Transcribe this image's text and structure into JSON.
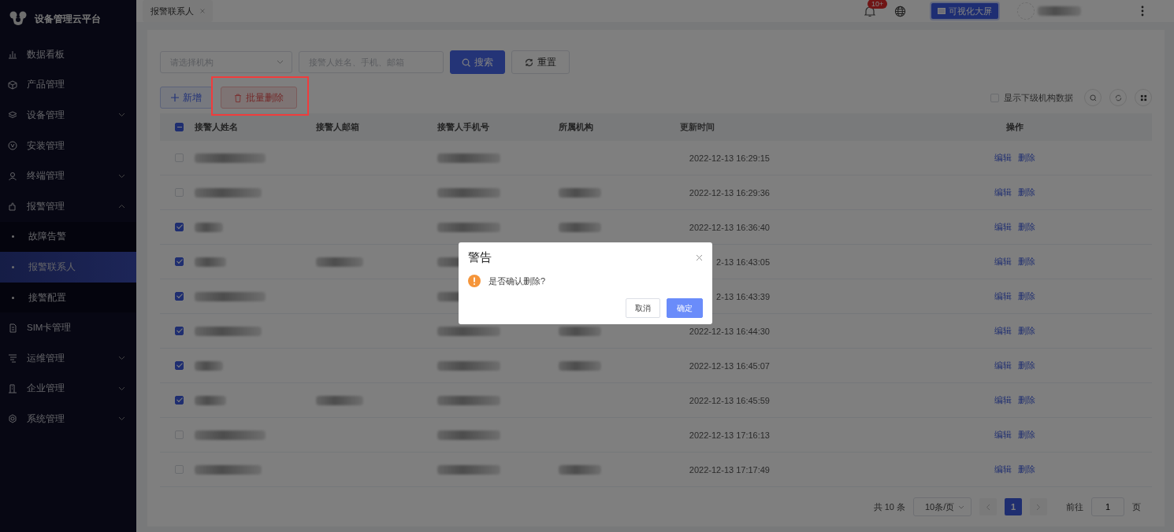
{
  "brand": {
    "title": "设备管理云平台"
  },
  "sidebar": {
    "items": [
      {
        "label": "数据看板",
        "kind": "chart",
        "selected": false
      },
      {
        "label": "产品管理",
        "kind": "cube",
        "selected": false
      },
      {
        "label": "设备管理",
        "kind": "layers",
        "expanded": false,
        "selected": false
      },
      {
        "label": "安装管理",
        "kind": "shield",
        "selected": false
      },
      {
        "label": "终端管理",
        "kind": "user",
        "expanded": false,
        "selected": false
      },
      {
        "label": "报警管理",
        "kind": "puzzle",
        "expanded": true,
        "selected": false,
        "children": [
          {
            "label": "故障告警",
            "selected": false
          },
          {
            "label": "报警联系人",
            "selected": true
          },
          {
            "label": "接警配置",
            "selected": false
          }
        ]
      },
      {
        "label": "SIM卡管理",
        "kind": "sim",
        "selected": false
      },
      {
        "label": "运维管理",
        "kind": "tools",
        "expanded": false,
        "selected": false
      },
      {
        "label": "企业管理",
        "kind": "building",
        "expanded": false,
        "selected": false
      },
      {
        "label": "系统管理",
        "kind": "gear",
        "expanded": false,
        "selected": false
      }
    ]
  },
  "tabs": [
    {
      "label": "报警联系人"
    }
  ],
  "header": {
    "badge": "10+",
    "screen_button": "可视化大屏"
  },
  "filters": {
    "org_placeholder": "请选择机构",
    "search_placeholder": "接警人姓名、手机、邮箱",
    "search_button": "搜索",
    "reset_button": "重置"
  },
  "actions": {
    "add_button": "新增",
    "batch_delete_button": "批量删除",
    "batch_delete_annotated": true,
    "sub_org_label": "显示下级机构数据",
    "sub_org_checked": false
  },
  "table": {
    "select_all_indeterminate": true,
    "columns": [
      "接警人姓名",
      "接警人邮箱",
      "接警人手机号",
      "所属机构",
      "更新时间",
      "操作"
    ],
    "rows": [
      {
        "checked": false,
        "updated": "2022-12-13 16:29:15",
        "actions": [
          "编辑",
          "删除"
        ]
      },
      {
        "checked": false,
        "updated": "2022-12-13 16:29:36",
        "actions": [
          "编辑",
          "删除"
        ]
      },
      {
        "checked": true,
        "updated": "2022-12-13 16:36:40",
        "actions": [
          "编辑",
          "删除"
        ]
      },
      {
        "checked": true,
        "updated": "2-13 16:43:05",
        "actions": [
          "编辑",
          "删除"
        ]
      },
      {
        "checked": true,
        "updated": "2-13 16:43:39",
        "actions": [
          "编辑",
          "删除"
        ]
      },
      {
        "checked": true,
        "updated": "2022-12-13 16:44:30",
        "actions": [
          "编辑",
          "删除"
        ]
      },
      {
        "checked": true,
        "updated": "2022-12-13 16:45:07",
        "actions": [
          "编辑",
          "删除"
        ]
      },
      {
        "checked": true,
        "updated": "2022-12-13 16:45:59",
        "actions": [
          "编辑",
          "删除"
        ]
      },
      {
        "checked": false,
        "updated": "2022-12-13 17:16:13",
        "actions": [
          "编辑",
          "删除"
        ]
      },
      {
        "checked": false,
        "updated": "2022-12-13 17:17:49",
        "actions": [
          "编辑",
          "删除"
        ]
      }
    ]
  },
  "pagination": {
    "total": "共 10 条",
    "page_size": "10条/页",
    "pages": [
      {
        "label": "1",
        "selected": true
      }
    ],
    "goto_label": "前往",
    "goto_value": "1",
    "goto_suffix": "页"
  },
  "dialog": {
    "title": "警告",
    "message": "是否确认删除?",
    "cancel": "取消",
    "confirm": "确定"
  }
}
